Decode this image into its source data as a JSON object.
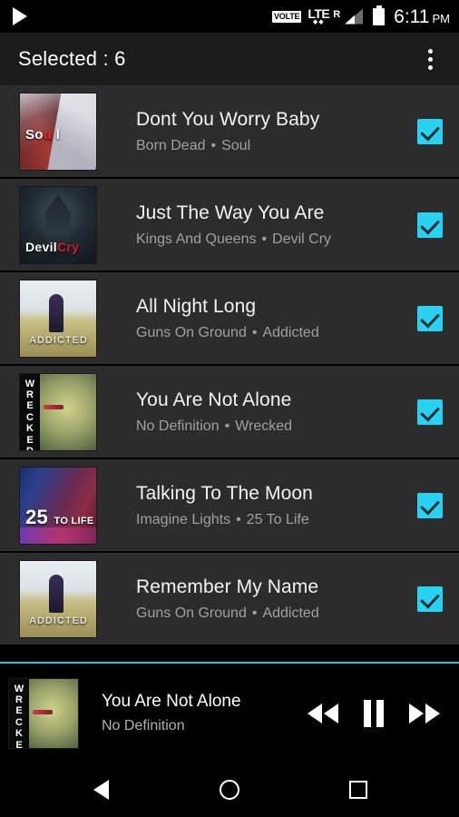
{
  "status_bar": {
    "play_icon": "play-icon",
    "volte_label": "VOLTE",
    "network_label": "LTE",
    "roaming_label": "R",
    "signal_icon": "signal-bars-icon",
    "battery_icon": "battery-icon",
    "time": "6:11",
    "ampm": "PM"
  },
  "app_bar": {
    "title": "Selected : 6",
    "overflow_icon": "more-vertical-icon"
  },
  "theme": {
    "accent": "#2ad2f2",
    "row_bg": "#2c2c2c",
    "app_bar_bg": "#1b1b1b",
    "title_color": "#f2f2f2",
    "subtitle_color": "#a0a0a0"
  },
  "songs": [
    {
      "title": "Dont You Worry Baby",
      "artist": "Born Dead",
      "album": "Soul",
      "separator": "•",
      "art_label_a": "So",
      "art_label_b": "u",
      "art_label_c": "l",
      "art_class": "soul",
      "checked": true
    },
    {
      "title": "Just The Way You Are",
      "artist": "Kings And Queens",
      "album": "Devil Cry",
      "separator": "•",
      "art_label_a": "Devil",
      "art_label_b": "Cry",
      "art_label_c": "",
      "art_class": "devil",
      "checked": true
    },
    {
      "title": "All Night Long",
      "artist": "Guns On Ground",
      "album": "Addicted",
      "separator": "•",
      "art_label_a": "ADDICTED",
      "art_label_b": "",
      "art_label_c": "",
      "art_class": "addicted",
      "checked": true
    },
    {
      "title": "You Are Not Alone",
      "artist": "No Definition",
      "album": "Wrecked",
      "separator": "•",
      "art_label_a": "W R E C K E D",
      "art_label_b": "",
      "art_label_c": "",
      "art_class": "wrecked",
      "checked": true
    },
    {
      "title": "Talking To The Moon",
      "artist": "Imagine Lights",
      "album": "25 To Life",
      "separator": "•",
      "art_label_a": "25",
      "art_label_b": "TO LIFE",
      "art_label_c": "",
      "art_class": "life",
      "checked": true
    },
    {
      "title": "Remember My Name",
      "artist": "Guns On Ground",
      "album": "Addicted",
      "separator": "•",
      "art_label_a": "ADDICTED",
      "art_label_b": "",
      "art_label_c": "",
      "art_class": "addicted",
      "checked": true
    }
  ],
  "now_playing": {
    "title": "You Are Not Alone",
    "artist": "No Definition",
    "art_class": "wrecked",
    "art_label": "W R E C K E D",
    "prev_icon": "rewind-icon",
    "play_pause_icon": "pause-icon",
    "next_icon": "fast-forward-icon"
  },
  "nav_bar": {
    "back_icon": "back-triangle-icon",
    "home_icon": "home-circle-icon",
    "recents_icon": "recents-square-icon"
  }
}
